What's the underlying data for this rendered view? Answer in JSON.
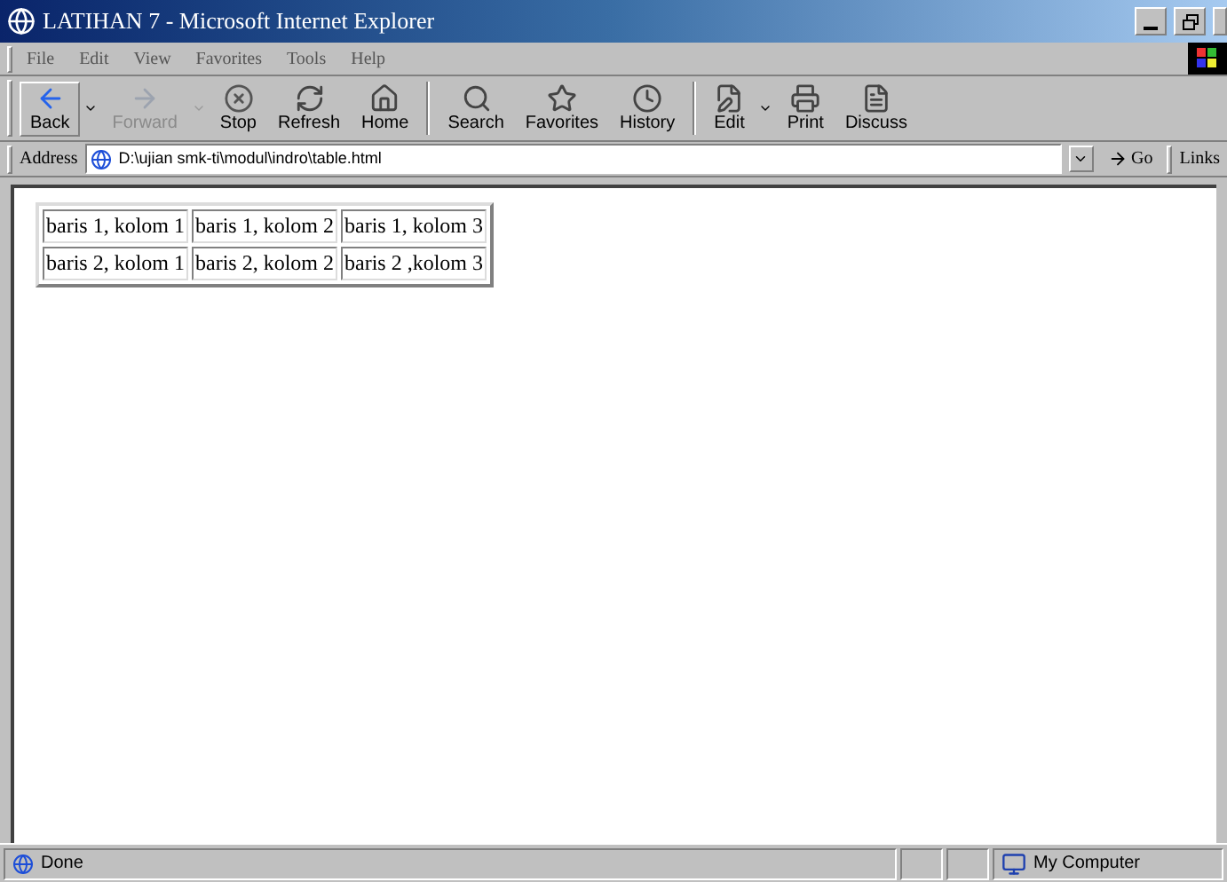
{
  "window": {
    "title": "LATIHAN 7 - Microsoft Internet Explorer"
  },
  "menu": [
    "File",
    "Edit",
    "View",
    "Favorites",
    "Tools",
    "Help"
  ],
  "toolbar": [
    {
      "label": "Back",
      "disabled": false,
      "dropdown": true
    },
    {
      "label": "Forward",
      "disabled": true,
      "dropdown": true
    },
    {
      "label": "Stop",
      "disabled": false,
      "dropdown": false
    },
    {
      "label": "Refresh",
      "disabled": false,
      "dropdown": false
    },
    {
      "label": "Home",
      "disabled": false,
      "dropdown": false
    },
    {
      "label": "Search",
      "disabled": false,
      "dropdown": false
    },
    {
      "label": "Favorites",
      "disabled": false,
      "dropdown": false
    },
    {
      "label": "History",
      "disabled": false,
      "dropdown": false
    },
    {
      "label": "Edit",
      "disabled": false,
      "dropdown": true
    },
    {
      "label": "Print",
      "disabled": false,
      "dropdown": false
    },
    {
      "label": "Discuss",
      "disabled": false,
      "dropdown": false
    }
  ],
  "address_bar": {
    "label": "Address",
    "value": "D:\\ujian smk-ti\\modul\\indro\\table.html",
    "go": "Go",
    "links": "Links"
  },
  "table": {
    "rows": [
      [
        "baris 1, kolom 1",
        "baris 1, kolom 2",
        "baris 1, kolom 3"
      ],
      [
        "baris 2, kolom 1",
        "baris 2, kolom 2",
        "baris 2 ,kolom 3"
      ]
    ]
  },
  "status_bar": {
    "text": "Done",
    "zone": "My Computer"
  }
}
